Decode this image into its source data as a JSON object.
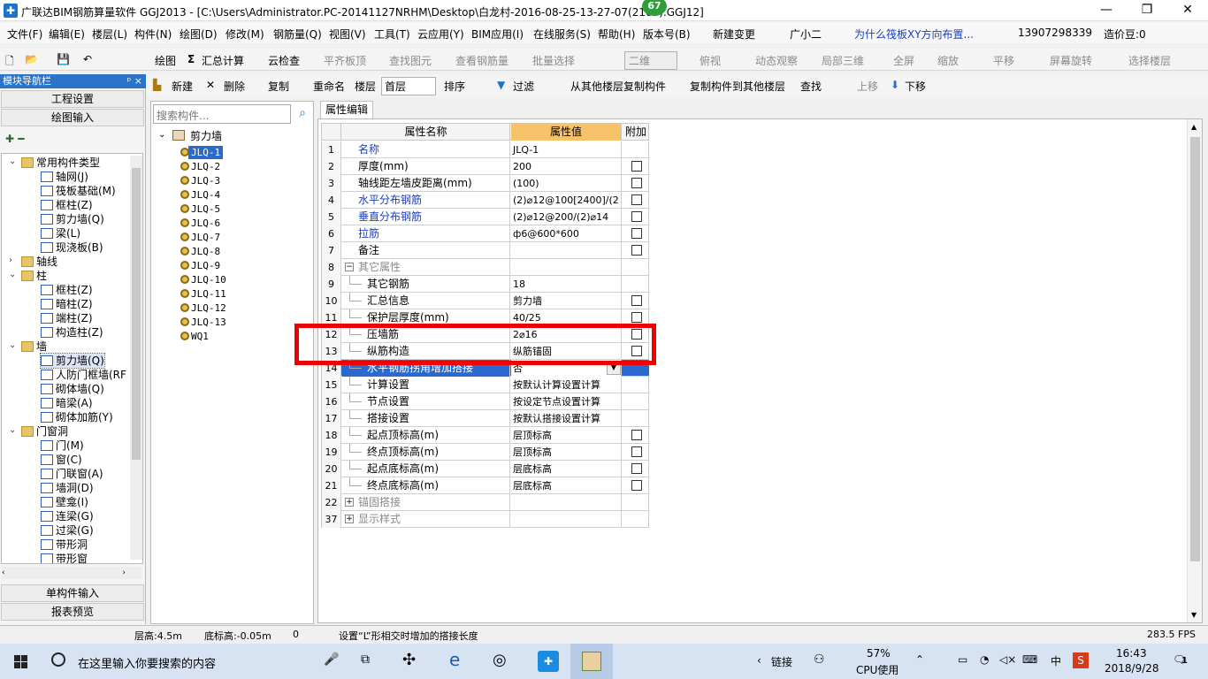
{
  "title": {
    "app": "广联达BIM钢筋算量软件 GGJ2013 - [C:\\Users\\Administrator.PC-20141127NRHM\\Desktop\\白龙村-2016-08-25-13-27-07(2165).GGJ12]",
    "badge": "67",
    "min": "—",
    "max": "❐",
    "close": "✕"
  },
  "menu": [
    "文件(F)",
    "编辑(E)",
    "楼层(L)",
    "构件(N)",
    "绘图(D)",
    "修改(M)",
    "钢筋量(Q)",
    "视图(V)",
    "工具(T)",
    "云应用(Y)",
    "BIM应用(I)",
    "在线服务(S)",
    "帮助(H)",
    "版本号(B)",
    "新建变更",
    "广小二",
    "为什么筏板XY方向布置...",
    "13907298339",
    "造价豆:0"
  ],
  "toolbar1": {
    "draw": "绘图",
    "sum": "汇总计算",
    "cloudcheck": "云检查",
    "flat": "平齐板顶",
    "find": "查找图元",
    "view_rebar": "查看钢筋量",
    "batch": "批量选择",
    "dim": "二维",
    "plan": "俯视",
    "dynamic": "动态观察",
    "local3d": "局部三维",
    "full": "全屏",
    "zoom": "缩放",
    "pan": "平移",
    "rotate": "屏幕旋转",
    "select_floor": "选择楼层"
  },
  "toolbar2": {
    "new": "新建",
    "delete": "删除",
    "copy": "复制",
    "rename": "重命名",
    "floor_label": "楼层",
    "floor_value": "首层",
    "sort": "排序",
    "filter": "过滤",
    "copy_from": "从其他楼层复制构件",
    "copy_to": "复制构件到其他楼层",
    "find": "查找",
    "up": "上移",
    "down": "下移"
  },
  "nav": {
    "header": "模块导航栏",
    "pin": "ᵖ ×",
    "btn_project": "工程设置",
    "btn_draw": "绘图输入",
    "btn_single": "单构件输入",
    "btn_report": "报表预览",
    "tree": [
      {
        "label": "常用构件类型",
        "level": 0,
        "type": "folder",
        "exp": "⌄"
      },
      {
        "label": "轴网(J)",
        "level": 1,
        "type": "comp"
      },
      {
        "label": "筏板基础(M)",
        "level": 1,
        "type": "comp"
      },
      {
        "label": "框柱(Z)",
        "level": 1,
        "type": "comp"
      },
      {
        "label": "剪力墙(Q)",
        "level": 1,
        "type": "comp"
      },
      {
        "label": "梁(L)",
        "level": 1,
        "type": "comp"
      },
      {
        "label": "现浇板(B)",
        "level": 1,
        "type": "comp"
      },
      {
        "label": "轴线",
        "level": 0,
        "type": "folder",
        "exp": "›"
      },
      {
        "label": "柱",
        "level": 0,
        "type": "folder",
        "exp": "⌄"
      },
      {
        "label": "框柱(Z)",
        "level": 1,
        "type": "comp"
      },
      {
        "label": "暗柱(Z)",
        "level": 1,
        "type": "comp"
      },
      {
        "label": "端柱(Z)",
        "level": 1,
        "type": "comp"
      },
      {
        "label": "构造柱(Z)",
        "level": 1,
        "type": "comp"
      },
      {
        "label": "墙",
        "level": 0,
        "type": "folder",
        "exp": "⌄"
      },
      {
        "label": "剪力墙(Q)",
        "level": 1,
        "type": "comp",
        "selected": true
      },
      {
        "label": "人防门框墙(RF",
        "level": 1,
        "type": "comp"
      },
      {
        "label": "砌体墙(Q)",
        "level": 1,
        "type": "comp"
      },
      {
        "label": "暗梁(A)",
        "level": 1,
        "type": "comp"
      },
      {
        "label": "砌体加筋(Y)",
        "level": 1,
        "type": "comp"
      },
      {
        "label": "门窗洞",
        "level": 0,
        "type": "folder",
        "exp": "⌄"
      },
      {
        "label": "门(M)",
        "level": 1,
        "type": "comp"
      },
      {
        "label": "窗(C)",
        "level": 1,
        "type": "comp"
      },
      {
        "label": "门联窗(A)",
        "level": 1,
        "type": "comp"
      },
      {
        "label": "墙洞(D)",
        "level": 1,
        "type": "comp"
      },
      {
        "label": "壁龛(I)",
        "level": 1,
        "type": "comp"
      },
      {
        "label": "连梁(G)",
        "level": 1,
        "type": "comp"
      },
      {
        "label": "过梁(G)",
        "level": 1,
        "type": "comp"
      },
      {
        "label": "带形洞",
        "level": 1,
        "type": "comp"
      },
      {
        "label": "带形窗",
        "level": 1,
        "type": "comp"
      }
    ]
  },
  "comp": {
    "search_placeholder": "搜索构件...",
    "root": "剪力墙",
    "items": [
      "JLQ-1",
      "JLQ-2",
      "JLQ-3",
      "JLQ-4",
      "JLQ-5",
      "JLQ-6",
      "JLQ-7",
      "JLQ-8",
      "JLQ-9",
      "JLQ-10",
      "JLQ-11",
      "JLQ-12",
      "JLQ-13",
      "WQ1"
    ]
  },
  "props": {
    "tab": "属性编辑",
    "headers": {
      "name": "属性名称",
      "value": "属性值",
      "extra": "附加"
    },
    "rows": [
      {
        "no": "1",
        "name": "名称",
        "value": "JLQ-1",
        "chk": false,
        "style": "blue",
        "indent": 0
      },
      {
        "no": "2",
        "name": "厚度(mm)",
        "value": "200",
        "chk": true,
        "indent": 0
      },
      {
        "no": "3",
        "name": "轴线距左墙皮距离(mm)",
        "value": "(100)",
        "chk": true,
        "indent": 0
      },
      {
        "no": "4",
        "name": "水平分布钢筋",
        "value": "(2)⌀12@100[2400]/(2",
        "chk": true,
        "style": "blue",
        "indent": 0
      },
      {
        "no": "5",
        "name": "垂直分布钢筋",
        "value": "(2)⌀12@200/(2)⌀14",
        "chk": true,
        "style": "blue",
        "indent": 0
      },
      {
        "no": "6",
        "name": "拉筋",
        "value": "ф6@600*600",
        "chk": true,
        "style": "blue",
        "indent": 0
      },
      {
        "no": "7",
        "name": "备注",
        "value": "",
        "chk": true,
        "indent": 0
      },
      {
        "no": "8",
        "name": "其它属性",
        "value": "",
        "chk": false,
        "style": "gray",
        "indent": 0,
        "group": "−"
      },
      {
        "no": "9",
        "name": "其它钢筋",
        "value": "18",
        "chk": false,
        "indent": 1
      },
      {
        "no": "10",
        "name": "汇总信息",
        "value": "剪力墙",
        "chk": true,
        "indent": 1
      },
      {
        "no": "11",
        "name": "保护层厚度(mm)",
        "value": "40/25",
        "chk": true,
        "indent": 1
      },
      {
        "no": "12",
        "name": "压墙筋",
        "value": "2⌀16",
        "chk": true,
        "indent": 1
      },
      {
        "no": "13",
        "name": "纵筋构造",
        "value": "纵筋锚固",
        "chk": true,
        "indent": 1
      },
      {
        "no": "14",
        "name": "水平钢筋拐角增加搭接",
        "value": "否",
        "chk": false,
        "indent": 1,
        "selected": true
      },
      {
        "no": "15",
        "name": "计算设置",
        "value": "按默认计算设置计算",
        "chk": false,
        "indent": 1
      },
      {
        "no": "16",
        "name": "节点设置",
        "value": "按设定节点设置计算",
        "chk": false,
        "indent": 1
      },
      {
        "no": "17",
        "name": "搭接设置",
        "value": "按默认搭接设置计算",
        "chk": false,
        "indent": 1
      },
      {
        "no": "18",
        "name": "起点顶标高(m)",
        "value": "层顶标高",
        "chk": true,
        "indent": 1
      },
      {
        "no": "19",
        "name": "终点顶标高(m)",
        "value": "层顶标高",
        "chk": true,
        "indent": 1
      },
      {
        "no": "20",
        "name": "起点底标高(m)",
        "value": "层底标高",
        "chk": true,
        "indent": 1
      },
      {
        "no": "21",
        "name": "终点底标高(m)",
        "value": "层底标高",
        "chk": true,
        "indent": 1
      },
      {
        "no": "22",
        "name": "锚固搭接",
        "value": "",
        "chk": false,
        "style": "gray",
        "indent": 0,
        "group": "+"
      },
      {
        "no": "37",
        "name": "显示样式",
        "value": "",
        "chk": false,
        "style": "gray",
        "indent": 0,
        "group": "+"
      }
    ]
  },
  "status": {
    "floor_height": "层高:4.5m",
    "base_elev": "底标高:-0.05m",
    "zero": "0",
    "hint": "设置“L”形相交时增加的搭接长度",
    "fps": "283.5 FPS"
  },
  "taskbar": {
    "search": "在这里输入你要搜索的内容",
    "link": "链接",
    "cpu_pct": "57%",
    "cpu_label": "CPU使用",
    "ime": "中",
    "time": "16:43",
    "date": "2018/9/28",
    "notif": "1"
  }
}
